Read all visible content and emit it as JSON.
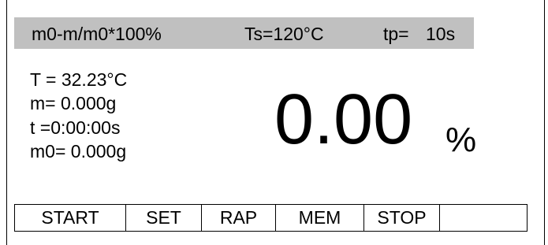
{
  "header": {
    "formula": "m0-m/m0*100%",
    "ts": "Ts=120°C",
    "tp_label": "tp=",
    "tp_value": "10s"
  },
  "readouts": {
    "temperature": "T = 32.23°C",
    "mass": "m= 0.000g",
    "time": "t =0:00:00s",
    "initial_mass": "m0= 0.000g"
  },
  "result": {
    "value": "0.00",
    "unit": "%"
  },
  "softkeys": {
    "start": "START",
    "set": "SET",
    "rap": "RAP",
    "mem": "MEM",
    "stop": "STOP",
    "blank": ""
  }
}
